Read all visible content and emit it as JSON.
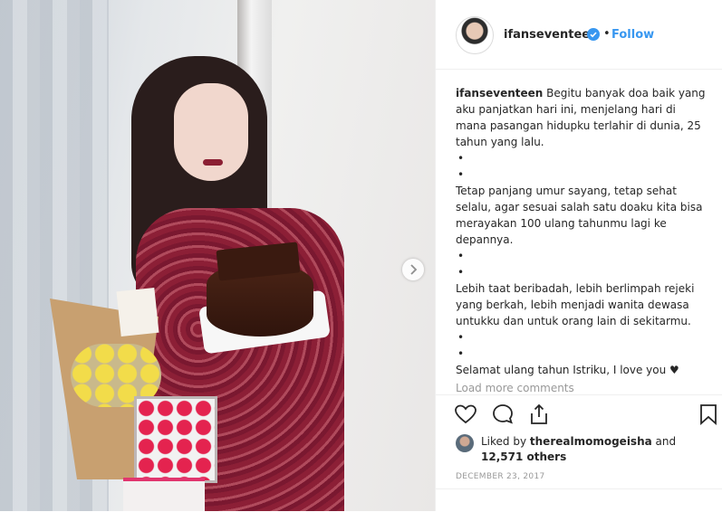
{
  "post": {
    "username": "ifanseventeen",
    "follow_label": "Follow",
    "separator": "•",
    "caption": {
      "lines": [
        {
          "text": "Begitu banyak doa baik yang aku panjatkan hari ini, menjelang hari di mana pasangan hidupku terlahir di dunia, 25 tahun yang lalu."
        },
        {
          "text": "•"
        },
        {
          "text": "•"
        },
        {
          "text": "Tetap panjang umur sayang, tetap sehat selalu, agar sesuai salah satu doaku kita bisa merayakan 100 ulang tahunmu lagi ke depannya."
        },
        {
          "text": "•"
        },
        {
          "text": "•"
        },
        {
          "text": "Lebih taat beribadah, lebih berlimpah rejeki yang berkah, lebih menjadi wanita dewasa untukku dan untuk orang lain di sekitarmu."
        },
        {
          "text": "•"
        },
        {
          "text": "•"
        },
        {
          "text": "Selamat ulang tahun Istriku, I love you ♥"
        }
      ]
    },
    "load_more": "Load more comments",
    "likes": {
      "prefix": "Liked by",
      "user": "therealmomogeisha",
      "conjunction": "and",
      "count": "12,571 others"
    },
    "date": "DECEMBER 23, 2017"
  },
  "colors": {
    "link_blue": "#3897f0",
    "text": "#262626",
    "muted": "#999999",
    "border": "#efefef"
  },
  "icons": [
    "verified-badge-icon",
    "next-arrow-icon",
    "heart-icon",
    "comment-icon",
    "share-icon",
    "bookmark-icon"
  ]
}
